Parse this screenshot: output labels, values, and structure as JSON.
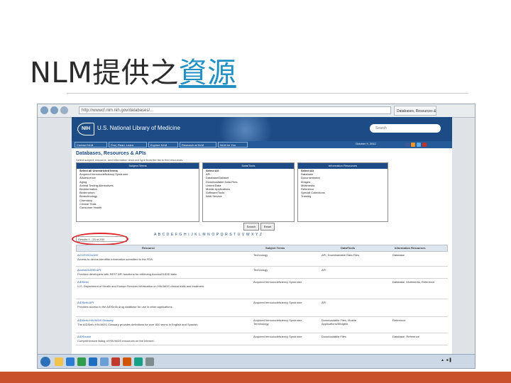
{
  "slide": {
    "title_prefix": "NLM提供之",
    "title_link": "資源",
    "footer_color": "#c9522c"
  },
  "browser": {
    "url": "http://wwwcf.nlm.nih.gov/databases/...",
    "tab_label": "Databases, Resources & ..."
  },
  "banner": {
    "logo": "NIH",
    "library_name": "U.S. National Library of Medicine",
    "search_placeholder": "Search"
  },
  "menu": {
    "items": [
      "Contact NLM",
      "Find, Read, Learn",
      "Explore NLM",
      "Research at NLM",
      "NLM for You"
    ],
    "date": "October 9, 2012"
  },
  "content": {
    "heading": "Databases, Resources & APIs",
    "subtext": "Select subject, resource, and information resource type from the list to find resources.",
    "panels": [
      {
        "header": "Subject Terms",
        "options": [
          "Select all Unrestricted terms",
          "Acquired Immunodeficiency Syndrome",
          "Adolescence",
          "Aging",
          "Animal Testing Alternatives",
          "Bioinformatics",
          "Bioterrorism",
          "Biotechnology",
          "Chemistry",
          "Clinical Trials",
          "Consumer Health"
        ]
      },
      {
        "header": "Data/Tools",
        "options": [
          "Select All",
          "API",
          "Database/Dataset",
          "Downloadable Data Files",
          "Linked Data",
          "Mobile Applications",
          "Software/Tools",
          "Web Service"
        ]
      },
      {
        "header": "Information Resources",
        "options": [
          "Select All",
          "Database",
          "Documentation",
          "Images",
          "Multimedia",
          "Reference",
          "Special Collections",
          "Training"
        ]
      }
    ],
    "search_button": "Search",
    "reset_button": "Reset",
    "alphabet": "A B C D E F G H I J K L M N O P Q R S T U V W X Y Z",
    "results_count": "Results 1 - 25 of 200"
  },
  "table": {
    "headers": [
      "Resource",
      "Subject Terms",
      "Data/Tools",
      "Information Resources"
    ],
    "rows": [
      {
        "name": "ACCESSGUDID",
        "desc": "Access to device identifier information submitted to the FDA.",
        "subject": "Technology",
        "tools": "API, Downloadable Data Files",
        "info": "Database"
      },
      {
        "name": "AccessGUDID API",
        "desc": "Provides developers with REST API functions for retrieving AccessGUDID data.",
        "subject": "Technology",
        "tools": "API",
        "info": ""
      },
      {
        "name": "AIDSinfo",
        "desc": "U.S. Department of Health and Human Services information on HIV/AIDS clinical trials and treatment.",
        "subject": "Acquired Immunodeficiency Syndrome",
        "tools": "",
        "info": "Database, Multimedia, Reference"
      },
      {
        "name": "AIDSinfo API",
        "desc": "Provides access to the AIDSinfo drug database for use in other applications.",
        "subject": "Acquired Immunodeficiency Syndrome",
        "tools": "API",
        "info": ""
      },
      {
        "name": "AIDSinfo HIV/AIDS Glossary",
        "desc": "The AIDSinfo HIV/AIDS Glossary provides definitions for over 800 terms in English and Spanish.",
        "subject": "Acquired Immunodeficiency Syndrome, Terminology",
        "tools": "Downloadable Files, Mobile Applications/Widgets",
        "info": "Reference"
      },
      {
        "name": "AIDSource",
        "desc": "Comprehensive listing of HIV/AIDS resources on the Internet.",
        "subject": "Acquired Immunodeficiency Syndrome",
        "tools": "Downloadable Files",
        "info": "Database, Reference"
      }
    ]
  }
}
